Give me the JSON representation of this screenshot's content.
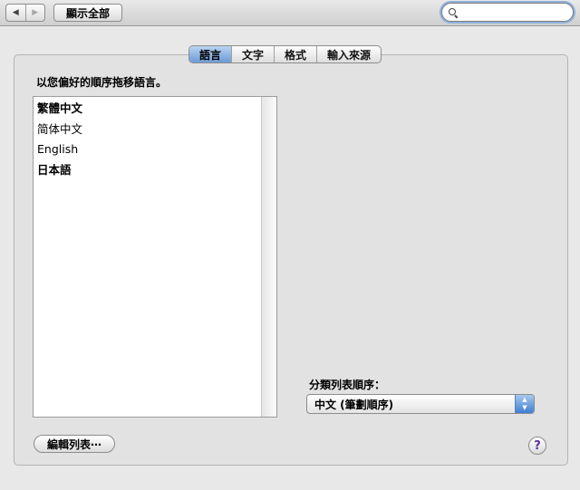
{
  "toolbar": {
    "back_icon": "◀",
    "forward_icon": "▶",
    "show_all_label": "顯示全部",
    "search_value": "",
    "search_icon": "search-icon"
  },
  "tabs": [
    {
      "label": "語言",
      "active": true
    },
    {
      "label": "文字",
      "active": false
    },
    {
      "label": "格式",
      "active": false
    },
    {
      "label": "輸入來源",
      "active": false
    }
  ],
  "language": {
    "drag_label": "以您偏好的順序拖移語言。",
    "items": [
      {
        "label": "繁體中文",
        "primary": true
      },
      {
        "label": "简体中文",
        "primary": false
      },
      {
        "label": "English",
        "primary": false
      },
      {
        "label": "日本語",
        "primary": true
      }
    ]
  },
  "sort": {
    "label": "分類列表順序：",
    "selected": "中文 (筆劃順序)"
  },
  "edit_list_label": "編輯列表⋯",
  "help_label": "?",
  "colors": {
    "accent": "#6d9ad7",
    "help": "#5b2fa7"
  }
}
